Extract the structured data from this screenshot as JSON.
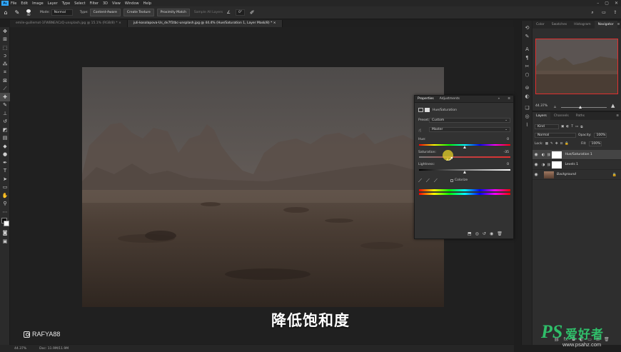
{
  "menu": [
    "File",
    "Edit",
    "Image",
    "Layer",
    "Type",
    "Select",
    "Filter",
    "3D",
    "View",
    "Window",
    "Help"
  ],
  "app_logo": "Ps",
  "options_bar": {
    "mode_label": "Mode:",
    "mode_value": "Normal",
    "type_label": "Type:",
    "type_btn1": "Content-Aware",
    "type_btn2": "Create Texture",
    "type_btn3": "Proximity Match",
    "sample_all": "Sample All Layers",
    "angle_value": "0°",
    "brush_size": "40"
  },
  "tabs": [
    {
      "label": "emile-guillemot-1FWBNEACzQ-unsplash.jpg @ 15.1% (RGB/8) *",
      "active": false
    },
    {
      "label": "juli-kosolapova-Us_dv7f1tbc-unsplash.jpg @ 44.4% (Hue/Saturation 1, Layer Mask/8) *",
      "active": true
    }
  ],
  "status": {
    "zoom": "44.37%",
    "doc": "Doc: 11.9M/11.9M"
  },
  "subtitle": "降低饱和度",
  "watermark_handle": "RAFYA88",
  "site_logo": {
    "ps": "PS",
    "cn": "爱好者",
    "url": "www.psahz.com"
  },
  "properties": {
    "tab_properties": "Properties",
    "tab_adjustments": "Adjustments",
    "adjustment_name": "Hue/Saturation",
    "preset_label": "Preset:",
    "preset_value": "Custom",
    "channel_value": "Master",
    "hue_label": "Hue:",
    "hue_value": "0",
    "saturation_label": "Saturation:",
    "saturation_value": "-35",
    "lightness_label": "Lightness:",
    "lightness_value": "0",
    "colorize_label": "Colorize"
  },
  "nav_tabs": [
    "Color",
    "Swatches",
    "Histogram",
    "Navigator"
  ],
  "nav_zoom": "44.37%",
  "layers_panel": {
    "tabs": [
      "Layers",
      "Channels",
      "Paths"
    ],
    "filter_value": "Kind",
    "blend_mode": "Normal",
    "opacity_label": "Opacity:",
    "opacity_value": "100%",
    "lock_label": "Lock:",
    "fill_label": "Fill:",
    "fill_value": "100%",
    "layers": [
      {
        "name": "Hue/Saturation 1",
        "selected": true
      },
      {
        "name": "Levels 1",
        "selected": false
      },
      {
        "name": "Background",
        "selected": false
      }
    ]
  },
  "colors": {
    "accent": "#31a8ff",
    "selection_red": "#e03030",
    "logo_green": "#2fbf6a"
  }
}
